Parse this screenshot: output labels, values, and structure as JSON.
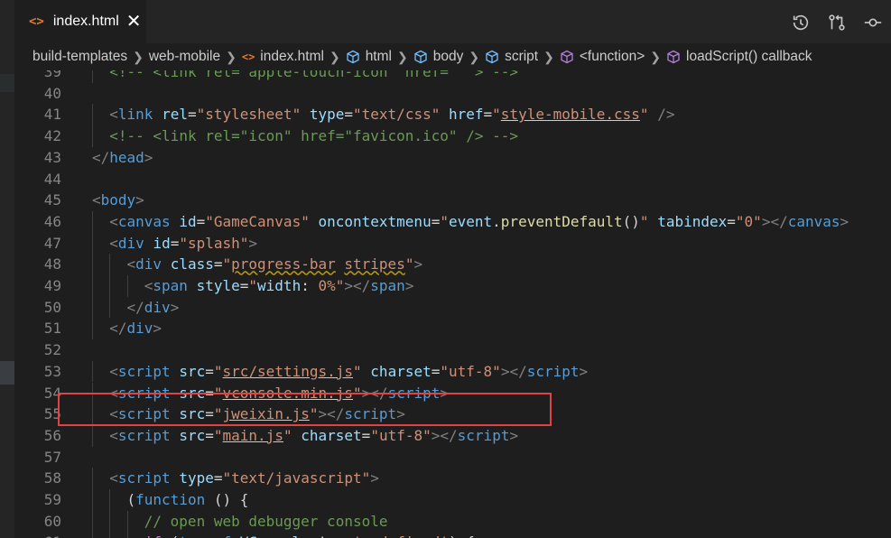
{
  "tab": {
    "icon": "<>",
    "label": "index.html",
    "close": "✕"
  },
  "toolbar": {
    "actions": [
      {
        "name": "timeline-icon",
        "label": "Open Timeline"
      },
      {
        "name": "compare-changes-icon",
        "label": "Open Changes"
      },
      {
        "name": "git-commit-icon",
        "label": "Commit"
      }
    ]
  },
  "breadcrumb": {
    "items": [
      {
        "label": "build-templates",
        "icon": ""
      },
      {
        "label": "web-mobile",
        "icon": ""
      },
      {
        "label": "index.html",
        "icon": "html-file-icon"
      },
      {
        "label": "html",
        "icon": "element-icon"
      },
      {
        "label": "body",
        "icon": "element-icon"
      },
      {
        "label": "script",
        "icon": "element-icon"
      },
      {
        "label": "<function>",
        "icon": "method-icon"
      },
      {
        "label": "loadScript() callback",
        "icon": "method-icon"
      }
    ]
  },
  "colors": {
    "editor_bg": "#1e1e1e",
    "tag": "#569cd6",
    "attribute": "#9cdcfe",
    "string": "#ce9178",
    "comment": "#6a9955",
    "highlight_box": "#e04343"
  },
  "code_lines": [
    {
      "n": "39",
      "indent": 2,
      "tokens": [
        [
          "com",
          "<!-- <link rel=\"apple-touch-icon\" href=\"\" > -->"
        ]
      ]
    },
    {
      "n": "40",
      "indent": 0,
      "tokens": []
    },
    {
      "n": "41",
      "indent": 2,
      "tokens": [
        [
          "punc",
          "<"
        ],
        [
          "tag",
          "link"
        ],
        [
          "txt",
          " "
        ],
        [
          "attr",
          "rel"
        ],
        [
          "txt",
          "="
        ],
        [
          "str",
          "\"stylesheet\""
        ],
        [
          "txt",
          " "
        ],
        [
          "attr",
          "type"
        ],
        [
          "txt",
          "="
        ],
        [
          "str",
          "\"text/css\""
        ],
        [
          "txt",
          " "
        ],
        [
          "attr",
          "href"
        ],
        [
          "txt",
          "="
        ],
        [
          "str",
          "\""
        ],
        [
          "str-ul",
          "style-mobile.css"
        ],
        [
          "str",
          "\""
        ],
        [
          "txt",
          " "
        ],
        [
          "punc",
          "/>"
        ]
      ]
    },
    {
      "n": "42",
      "indent": 2,
      "tokens": [
        [
          "com",
          "<!-- <link rel=\"icon\" href=\"favicon.ico\" /> -->"
        ]
      ]
    },
    {
      "n": "43",
      "indent": 0,
      "tokens": [
        [
          "punc",
          "</"
        ],
        [
          "tag",
          "head"
        ],
        [
          "punc",
          ">"
        ]
      ]
    },
    {
      "n": "44",
      "indent": 0,
      "tokens": []
    },
    {
      "n": "45",
      "indent": 0,
      "tokens": [
        [
          "punc",
          "<"
        ],
        [
          "tag",
          "body"
        ],
        [
          "punc",
          ">"
        ]
      ]
    },
    {
      "n": "46",
      "indent": 2,
      "tokens": [
        [
          "punc",
          "<"
        ],
        [
          "tag",
          "canvas"
        ],
        [
          "txt",
          " "
        ],
        [
          "attr",
          "id"
        ],
        [
          "txt",
          "="
        ],
        [
          "str",
          "\"GameCanvas\""
        ],
        [
          "txt",
          " "
        ],
        [
          "attr",
          "oncontextmenu"
        ],
        [
          "txt",
          "="
        ],
        [
          "str",
          "\""
        ],
        [
          "var",
          "event"
        ],
        [
          "txt",
          "."
        ],
        [
          "fn",
          "preventDefault"
        ],
        [
          "txt",
          "()"
        ],
        [
          "str",
          "\""
        ],
        [
          "txt",
          " "
        ],
        [
          "attr",
          "tabindex"
        ],
        [
          "txt",
          "="
        ],
        [
          "str",
          "\"0\""
        ],
        [
          "punc",
          "></"
        ],
        [
          "tag",
          "canvas"
        ],
        [
          "punc",
          ">"
        ]
      ]
    },
    {
      "n": "47",
      "indent": 2,
      "tokens": [
        [
          "punc",
          "<"
        ],
        [
          "tag",
          "div"
        ],
        [
          "txt",
          " "
        ],
        [
          "attr",
          "id"
        ],
        [
          "txt",
          "="
        ],
        [
          "str",
          "\"splash\""
        ],
        [
          "punc",
          ">"
        ]
      ]
    },
    {
      "n": "48",
      "indent": 4,
      "tokens": [
        [
          "punc",
          "<"
        ],
        [
          "tag",
          "div"
        ],
        [
          "txt",
          " "
        ],
        [
          "attr",
          "class"
        ],
        [
          "txt",
          "="
        ],
        [
          "str",
          "\""
        ],
        [
          "str-sq",
          "progress-bar"
        ],
        [
          "str",
          " "
        ],
        [
          "str-sq",
          "stripes"
        ],
        [
          "str",
          "\""
        ],
        [
          "punc",
          ">"
        ]
      ]
    },
    {
      "n": "49",
      "indent": 6,
      "tokens": [
        [
          "punc",
          "<"
        ],
        [
          "tag",
          "span"
        ],
        [
          "txt",
          " "
        ],
        [
          "attr",
          "style"
        ],
        [
          "txt",
          "="
        ],
        [
          "str",
          "\""
        ],
        [
          "attr",
          "width"
        ],
        [
          "txt",
          ": "
        ],
        [
          "str",
          "0%"
        ],
        [
          "str",
          "\""
        ],
        [
          "punc",
          "></"
        ],
        [
          "tag",
          "span"
        ],
        [
          "punc",
          ">"
        ]
      ]
    },
    {
      "n": "50",
      "indent": 4,
      "tokens": [
        [
          "punc",
          "</"
        ],
        [
          "tag",
          "div"
        ],
        [
          "punc",
          ">"
        ]
      ]
    },
    {
      "n": "51",
      "indent": 2,
      "tokens": [
        [
          "punc",
          "</"
        ],
        [
          "tag",
          "div"
        ],
        [
          "punc",
          ">"
        ]
      ]
    },
    {
      "n": "52",
      "indent": 0,
      "tokens": []
    },
    {
      "n": "53",
      "indent": 2,
      "tokens": [
        [
          "punc",
          "<"
        ],
        [
          "tag",
          "script"
        ],
        [
          "txt",
          " "
        ],
        [
          "attr",
          "src"
        ],
        [
          "txt",
          "="
        ],
        [
          "str",
          "\""
        ],
        [
          "str-ul",
          "src/settings.js"
        ],
        [
          "str",
          "\""
        ],
        [
          "txt",
          " "
        ],
        [
          "attr",
          "charset"
        ],
        [
          "txt",
          "="
        ],
        [
          "str",
          "\"utf-8\""
        ],
        [
          "punc",
          "></"
        ],
        [
          "tag",
          "script"
        ],
        [
          "punc",
          ">"
        ]
      ]
    },
    {
      "n": "54",
      "indent": 2,
      "tokens": [
        [
          "punc",
          "<"
        ],
        [
          "tag",
          "script"
        ],
        [
          "txt",
          " "
        ],
        [
          "attr",
          "src"
        ],
        [
          "txt",
          "="
        ],
        [
          "str",
          "\""
        ],
        [
          "str-ul",
          "vconsole.min.js"
        ],
        [
          "str",
          "\""
        ],
        [
          "punc",
          "></"
        ],
        [
          "tag",
          "script"
        ],
        [
          "punc",
          ">"
        ]
      ]
    },
    {
      "n": "55",
      "indent": 2,
      "tokens": [
        [
          "punc",
          "<"
        ],
        [
          "tag",
          "script"
        ],
        [
          "txt",
          " "
        ],
        [
          "attr",
          "src"
        ],
        [
          "txt",
          "="
        ],
        [
          "str",
          "\""
        ],
        [
          "str-ul",
          "jweixin.js"
        ],
        [
          "str",
          "\""
        ],
        [
          "punc",
          "></"
        ],
        [
          "tag",
          "script"
        ],
        [
          "punc",
          ">"
        ]
      ]
    },
    {
      "n": "56",
      "indent": 2,
      "tokens": [
        [
          "punc",
          "<"
        ],
        [
          "tag",
          "script"
        ],
        [
          "txt",
          " "
        ],
        [
          "attr",
          "src"
        ],
        [
          "txt",
          "="
        ],
        [
          "str",
          "\""
        ],
        [
          "str-ul",
          "main.js"
        ],
        [
          "str",
          "\""
        ],
        [
          "txt",
          " "
        ],
        [
          "attr",
          "charset"
        ],
        [
          "txt",
          "="
        ],
        [
          "str",
          "\"utf-8\""
        ],
        [
          "punc",
          "></"
        ],
        [
          "tag",
          "script"
        ],
        [
          "punc",
          ">"
        ]
      ]
    },
    {
      "n": "57",
      "indent": 0,
      "tokens": []
    },
    {
      "n": "58",
      "indent": 2,
      "tokens": [
        [
          "punc",
          "<"
        ],
        [
          "tag",
          "script"
        ],
        [
          "txt",
          " "
        ],
        [
          "attr",
          "type"
        ],
        [
          "txt",
          "="
        ],
        [
          "str",
          "\"text/javascript\""
        ],
        [
          "punc",
          ">"
        ]
      ]
    },
    {
      "n": "59",
      "indent": 4,
      "tokens": [
        [
          "txt",
          "("
        ],
        [
          "kw",
          "function"
        ],
        [
          "txt",
          " () {"
        ]
      ]
    },
    {
      "n": "60",
      "indent": 6,
      "tokens": [
        [
          "com",
          "// open web debugger console"
        ]
      ]
    },
    {
      "n": "61",
      "indent": 6,
      "tokens": [
        [
          "ctl",
          "if"
        ],
        [
          "txt",
          " ("
        ],
        [
          "kw",
          "typeof"
        ],
        [
          "txt",
          " "
        ],
        [
          "var",
          "VConsole"
        ],
        [
          "txt",
          " !== "
        ],
        [
          "str",
          "'undefined'"
        ],
        [
          "txt",
          ") {"
        ]
      ]
    }
  ],
  "highlighted_line": "55"
}
